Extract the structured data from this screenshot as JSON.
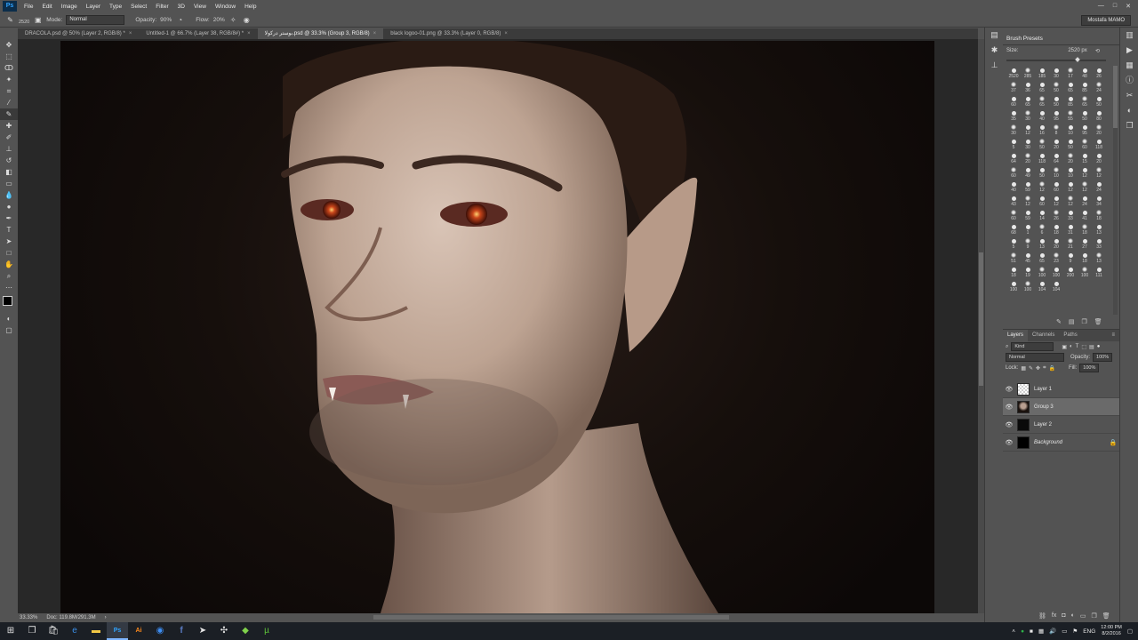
{
  "menu": [
    "File",
    "Edit",
    "Image",
    "Layer",
    "Type",
    "Select",
    "Filter",
    "3D",
    "View",
    "Window",
    "Help"
  ],
  "options": {
    "brush_size": "2520",
    "mode_label": "Mode:",
    "mode_value": "Normal",
    "opacity_label": "Opacity:",
    "opacity_value": "90%",
    "flow_label": "Flow:",
    "flow_value": "20%",
    "user": "Mostafa MAMO"
  },
  "tabs": [
    {
      "label": "DRACOLA.psd @ 50% (Layer 2, RGB/8) *"
    },
    {
      "label": "Untitled-1 @ 66.7% (Layer 38, RGB/8#) *"
    },
    {
      "label": "بوستر دركولا.psd @ 33.3% (Group 3, RGB/8)"
    },
    {
      "label": "black logoo-01.png @ 33.3% (Layer 0, RGB/8)"
    }
  ],
  "status": {
    "zoom": "33.33%",
    "doc": "Doc: 119.8M/291.3M"
  },
  "brush_presets": {
    "title": "Brush Presets",
    "size_label": "Size:",
    "size_value": "2520 px",
    "sizes": [
      "2520",
      "285",
      "185",
      "30",
      "17",
      "48",
      "26",
      "37",
      "36",
      "65",
      "50",
      "65",
      "85",
      "24",
      "60",
      "65",
      "65",
      "50",
      "85",
      "65",
      "50",
      "35",
      "30",
      "40",
      "95",
      "55",
      "50",
      "80",
      "30",
      "12",
      "16",
      "8",
      "10",
      "95",
      "20",
      "5",
      "30",
      "50",
      "20",
      "50",
      "60",
      "118",
      "64",
      "20",
      "118",
      "64",
      "20",
      "15",
      "20",
      "60",
      "49",
      "50",
      "10",
      "10",
      "12",
      "12",
      "40",
      "59",
      "12",
      "60",
      "12",
      "12",
      "24",
      "43",
      "12",
      "60",
      "12",
      "12",
      "24",
      "34",
      "60",
      "59",
      "14",
      "26",
      "33",
      "41",
      "18",
      "68",
      "1",
      "6",
      "18",
      "31",
      "18",
      "13",
      "5",
      "9",
      "13",
      "20",
      "21",
      "27",
      "33",
      "51",
      "45",
      "65",
      "23",
      "9",
      "18",
      "13",
      "18",
      "19",
      "100",
      "100",
      "200",
      "100",
      "111",
      "100",
      "100",
      "104",
      "104"
    ]
  },
  "layers": {
    "tabs": [
      "Layers",
      "Channels",
      "Paths"
    ],
    "kind_label": "Kind",
    "blend_mode": "Normal",
    "opacity_label": "Opacity:",
    "opacity_value": "100%",
    "lock_label": "Lock:",
    "fill_label": "Fill:",
    "fill_value": "100%",
    "items": [
      {
        "name": "Layer 1"
      },
      {
        "name": "Group 3"
      },
      {
        "name": "Layer 2"
      },
      {
        "name": "Background"
      }
    ]
  },
  "taskbar": {
    "lang": "ENG",
    "time": "12:00 PM",
    "date": "8/2/2016"
  }
}
